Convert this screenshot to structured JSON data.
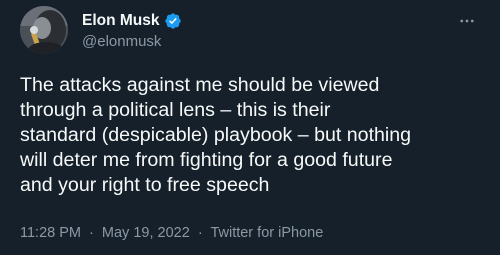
{
  "author": {
    "display_name": "Elon Musk",
    "handle": "@elonmusk",
    "verified_badge_icon": "verified-badge-icon",
    "avatar_icon": "profile-avatar"
  },
  "more_menu_icon": "more-options-icon",
  "tweet": {
    "text": "The attacks against me should be viewed\nthrough a political lens – this is their\nstandard (despicable) playbook – but nothing\nwill deter me from fighting for a good future\nand your right to free speech"
  },
  "meta": {
    "time": "11:28 PM",
    "separator": "·",
    "date": "May 19, 2022",
    "source": "Twitter for iPhone"
  },
  "colors": {
    "background": "#15202b",
    "primary_text": "#f7f9f9",
    "secondary_text": "#8b98a5",
    "verified_blue": "#1d9bf0"
  }
}
